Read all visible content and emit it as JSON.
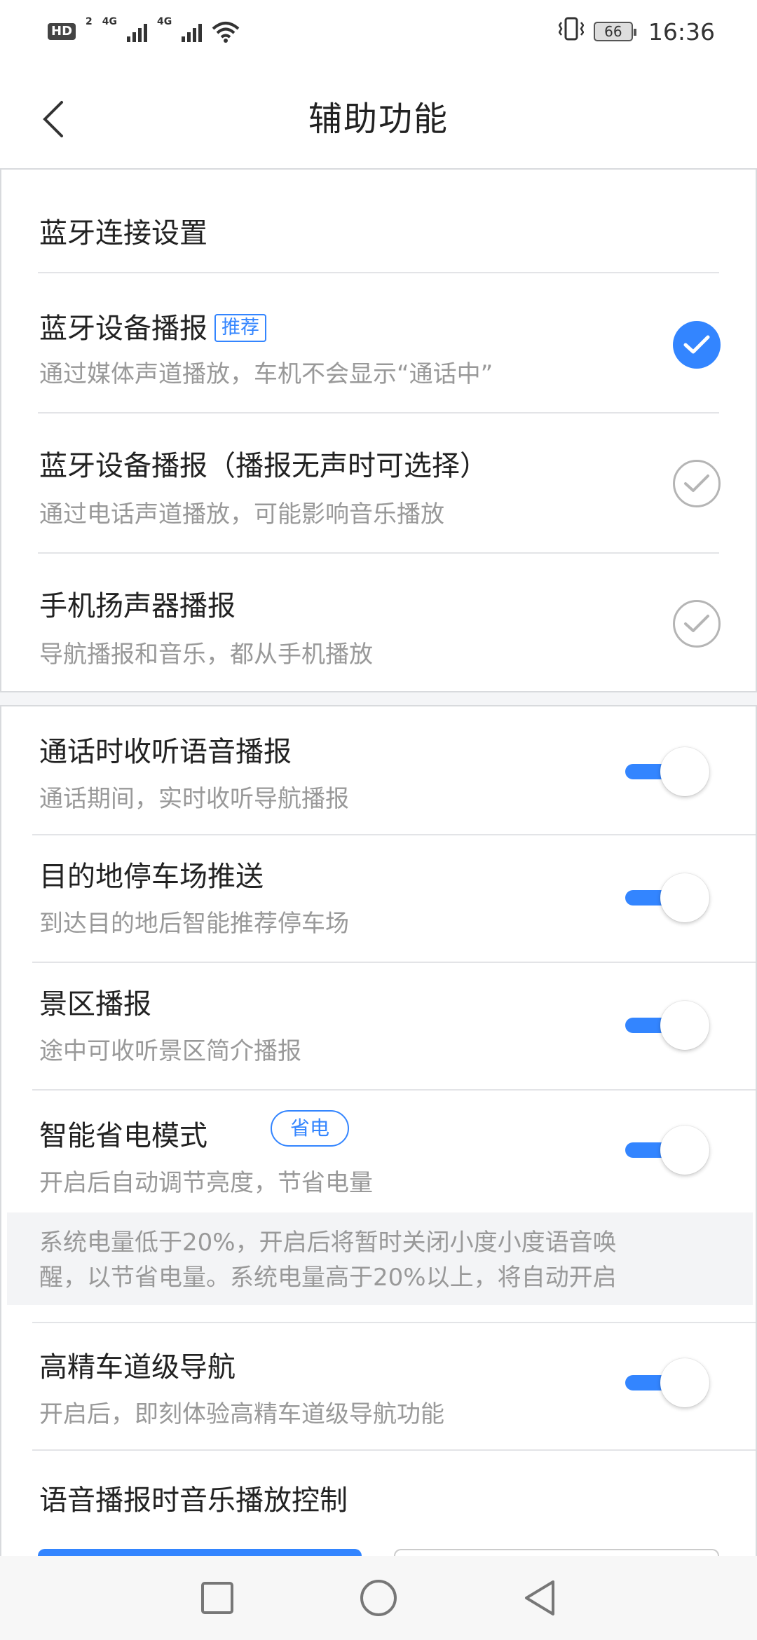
{
  "status_bar": {
    "hd": "HD",
    "sim1": "2",
    "net1": "4G",
    "net2": "4G",
    "battery": "66",
    "time": "16:36"
  },
  "header": {
    "title": "辅助功能"
  },
  "bluetooth": {
    "section_title": "蓝牙连接设置",
    "options": [
      {
        "title": "蓝牙设备播报",
        "tag": "推荐",
        "subtitle": "通过媒体声道播放，车机不会显示“通话中”",
        "selected": true
      },
      {
        "title": "蓝牙设备播报（播报无声时可选择）",
        "subtitle": "通过电话声道播放，可能影响音乐播放",
        "selected": false
      },
      {
        "title": "手机扬声器播报",
        "subtitle": "导航播报和音乐，都从手机播放",
        "selected": false
      }
    ]
  },
  "settings": {
    "items": [
      {
        "title": "通话时收听语音播报",
        "subtitle": "通话期间，实时收听导航播报",
        "on": true
      },
      {
        "title": "目的地停车场推送",
        "subtitle": "到达目的地后智能推荐停车场",
        "on": true
      },
      {
        "title": "景区播报",
        "subtitle": "途中可收听景区简介播报",
        "on": true
      },
      {
        "title": "智能省电模式",
        "tag": "省电",
        "subtitle": "开启后自动调节亮度，节省电量",
        "on": true,
        "note_line1": "系统电量低于20%，开启后将暂时关闭小度小度语音唤",
        "note_line2": "醒，以节省电量。系统电量高于20%以上，将自动开启"
      },
      {
        "title": "高精车道级导航",
        "subtitle": "开启后，即刻体验高精车道级导航功能",
        "on": true
      }
    ],
    "music_control_title": "语音播报时音乐播放控制"
  },
  "colors": {
    "accent": "#3385ff",
    "subtext": "#999999",
    "divider": "#e3e4e7"
  }
}
